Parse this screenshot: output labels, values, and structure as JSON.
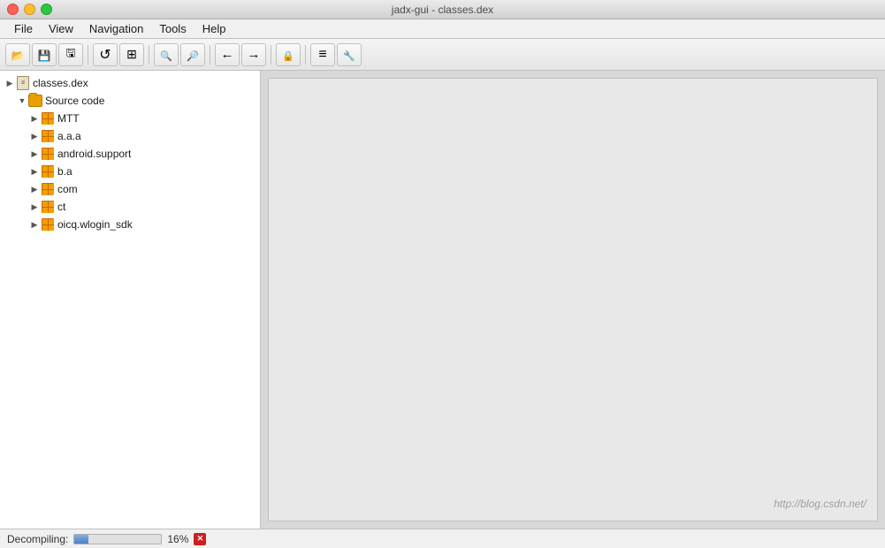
{
  "window": {
    "title": "jadx-gui - classes.dex",
    "buttons": {
      "close": "close",
      "minimize": "minimize",
      "maximize": "maximize"
    }
  },
  "menubar": {
    "items": [
      {
        "id": "file",
        "label": "File"
      },
      {
        "id": "view",
        "label": "View"
      },
      {
        "id": "navigation",
        "label": "Navigation"
      },
      {
        "id": "tools",
        "label": "Tools"
      },
      {
        "id": "help",
        "label": "Help"
      }
    ]
  },
  "toolbar": {
    "buttons": [
      {
        "id": "open",
        "icon": "open-icon",
        "label": "Open"
      },
      {
        "id": "save-all",
        "icon": "save-icon",
        "label": "Save All"
      },
      {
        "id": "save",
        "icon": "save2-icon",
        "label": "Save"
      },
      {
        "id": "back",
        "icon": "back-icon",
        "label": "Back"
      },
      {
        "id": "sync",
        "icon": "sync-icon",
        "label": "Sync"
      },
      {
        "id": "search",
        "icon": "search-icon",
        "label": "Search"
      },
      {
        "id": "search-adv",
        "icon": "search-adv-icon",
        "label": "Advanced Search"
      },
      {
        "id": "nav-back",
        "icon": "nav-back-icon",
        "label": "Navigate Back"
      },
      {
        "id": "nav-forward",
        "icon": "nav-forward-icon",
        "label": "Navigate Forward"
      },
      {
        "id": "lock",
        "icon": "lock-icon",
        "label": "Lock"
      },
      {
        "id": "decompile",
        "icon": "decompile-icon",
        "label": "Decompile"
      },
      {
        "id": "settings",
        "icon": "settings-icon",
        "label": "Settings"
      }
    ]
  },
  "tree": {
    "root": {
      "label": "classes.dex",
      "icon": "dex-file-icon"
    },
    "source_code": {
      "label": "Source code",
      "icon": "source-code-icon",
      "expanded": true
    },
    "packages": [
      {
        "id": "mtt",
        "label": "MTT",
        "icon": "package-icon",
        "expanded": false
      },
      {
        "id": "aaa",
        "label": "a.a.a",
        "icon": "package-icon",
        "expanded": false
      },
      {
        "id": "androidsupport",
        "label": "android.support",
        "icon": "package-icon",
        "expanded": false
      },
      {
        "id": "ba",
        "label": "b.a",
        "icon": "package-icon",
        "expanded": false
      },
      {
        "id": "com",
        "label": "com",
        "icon": "package-icon",
        "expanded": false
      },
      {
        "id": "ct",
        "label": "ct",
        "icon": "package-icon",
        "expanded": false
      },
      {
        "id": "oicq",
        "label": "oicq.wlogin_sdk",
        "icon": "package-icon",
        "expanded": false
      }
    ]
  },
  "status": {
    "label": "Decompiling:",
    "progress": 16,
    "progress_text": "16%",
    "cancel_label": "Cancel"
  },
  "watermark": "http://blog.csdn.net/"
}
